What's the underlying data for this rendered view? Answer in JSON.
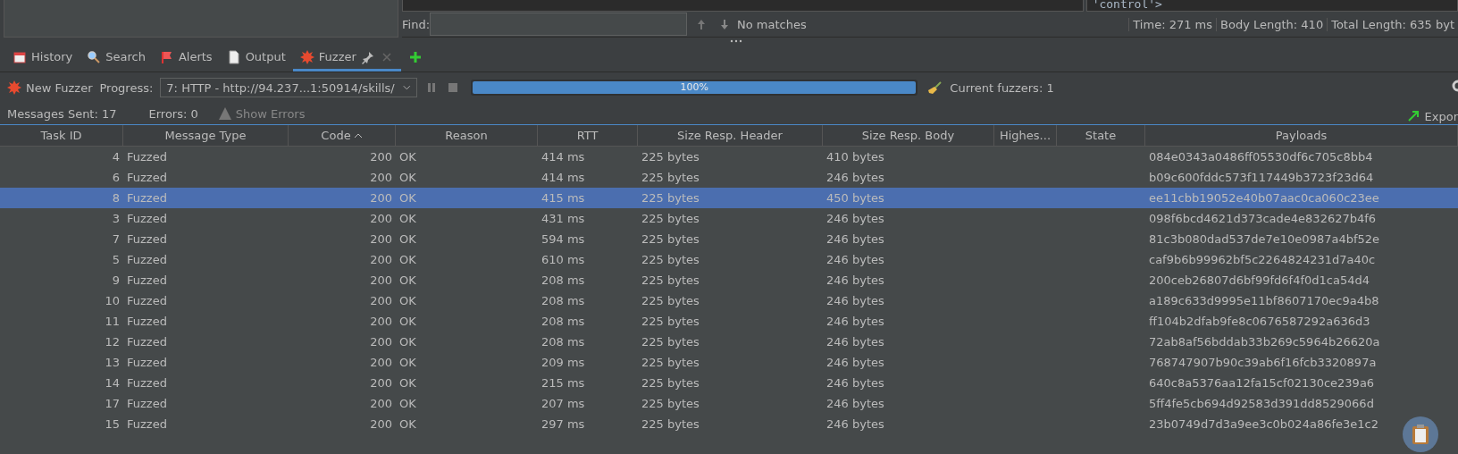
{
  "top_panel": {
    "code_snippet": "'control'>",
    "find": {
      "label": "Find:",
      "status": "No matches"
    },
    "stats": [
      "Time: 271 ms",
      "Body Length: 410",
      "Total Length: 635 byt"
    ]
  },
  "tabs": [
    {
      "label": "History",
      "kind": "calendar",
      "selected": false
    },
    {
      "label": "Search",
      "kind": "search",
      "selected": false
    },
    {
      "label": "Alerts",
      "kind": "flag",
      "selected": false
    },
    {
      "label": "Output",
      "kind": "document",
      "selected": false
    },
    {
      "label": "Fuzzer",
      "kind": "burst",
      "selected": true,
      "closable": true
    }
  ],
  "toolbar": {
    "new_button": "New Fuzzer",
    "progress_label": "Progress:",
    "progress_select": "7: HTTP - http://94.237...1:50914/skills/",
    "progress": {
      "level": 1,
      "reading": "100%"
    },
    "current_fuzzers": "Current fuzzers: 1"
  },
  "summary": {
    "messages_sent": "Messages Sent: 17",
    "errors": "Errors: 0",
    "show_errors": "Show Errors",
    "export": "Expor"
  },
  "table": {
    "columns": [
      {
        "label": "Task ID",
        "sorted": false
      },
      {
        "label": "Message Type",
        "sorted": false
      },
      {
        "label": "Code",
        "sorted": true
      },
      {
        "label": "Reason",
        "sorted": false
      },
      {
        "label": "RTT",
        "sorted": false
      },
      {
        "label": "Size Resp. Header",
        "sorted": false
      },
      {
        "label": "Size Resp. Body",
        "sorted": false
      },
      {
        "label": "Highes...",
        "sorted": false
      },
      {
        "label": "State",
        "sorted": false
      },
      {
        "label": "Payloads",
        "sorted": false
      }
    ],
    "rows": [
      {
        "cells": [
          "4",
          "Fuzzed",
          "200",
          "OK",
          "414 ms",
          "225 bytes",
          "410 bytes",
          "",
          "",
          "084e0343a0486ff05530df6c705c8bb4"
        ],
        "selected": false
      },
      {
        "cells": [
          "6",
          "Fuzzed",
          "200",
          "OK",
          "414 ms",
          "225 bytes",
          "246 bytes",
          "",
          "",
          "b09c600fddc573f117449b3723f23d64"
        ],
        "selected": false
      },
      {
        "cells": [
          "8",
          "Fuzzed",
          "200",
          "OK",
          "415 ms",
          "225 bytes",
          "450 bytes",
          "",
          "",
          "ee11cbb19052e40b07aac0ca060c23ee"
        ],
        "selected": true
      },
      {
        "cells": [
          "3",
          "Fuzzed",
          "200",
          "OK",
          "431 ms",
          "225 bytes",
          "246 bytes",
          "",
          "",
          "098f6bcd4621d373cade4e832627b4f6"
        ],
        "selected": false
      },
      {
        "cells": [
          "7",
          "Fuzzed",
          "200",
          "OK",
          "594 ms",
          "225 bytes",
          "246 bytes",
          "",
          "",
          "81c3b080dad537de7e10e0987a4bf52e"
        ],
        "selected": false
      },
      {
        "cells": [
          "5",
          "Fuzzed",
          "200",
          "OK",
          "610 ms",
          "225 bytes",
          "246 bytes",
          "",
          "",
          "caf9b6b99962bf5c2264824231d7a40c"
        ],
        "selected": false
      },
      {
        "cells": [
          "9",
          "Fuzzed",
          "200",
          "OK",
          "208 ms",
          "225 bytes",
          "246 bytes",
          "",
          "",
          "200ceb26807d6bf99fd6f4f0d1ca54d4"
        ],
        "selected": false
      },
      {
        "cells": [
          "10",
          "Fuzzed",
          "200",
          "OK",
          "208 ms",
          "225 bytes",
          "246 bytes",
          "",
          "",
          "a189c633d9995e11bf8607170ec9a4b8"
        ],
        "selected": false
      },
      {
        "cells": [
          "11",
          "Fuzzed",
          "200",
          "OK",
          "208 ms",
          "225 bytes",
          "246 bytes",
          "",
          "",
          "ff104b2dfab9fe8c0676587292a636d3"
        ],
        "selected": false
      },
      {
        "cells": [
          "12",
          "Fuzzed",
          "200",
          "OK",
          "208 ms",
          "225 bytes",
          "246 bytes",
          "",
          "",
          "72ab8af56bddab33b269c5964b26620a"
        ],
        "selected": false
      },
      {
        "cells": [
          "13",
          "Fuzzed",
          "200",
          "OK",
          "209 ms",
          "225 bytes",
          "246 bytes",
          "",
          "",
          "768747907b90c39ab6f16fcb3320897a"
        ],
        "selected": false
      },
      {
        "cells": [
          "14",
          "Fuzzed",
          "200",
          "OK",
          "215 ms",
          "225 bytes",
          "246 bytes",
          "",
          "",
          "640c8a5376aa12fa15cf02130ce239a6"
        ],
        "selected": false
      },
      {
        "cells": [
          "17",
          "Fuzzed",
          "200",
          "OK",
          "207 ms",
          "225 bytes",
          "246 bytes",
          "",
          "",
          "5ff4fe5cb694d92583d391dd8529066d"
        ],
        "selected": false
      },
      {
        "cells": [
          "15",
          "Fuzzed",
          "200",
          "OK",
          "297 ms",
          "225 bytes",
          "246 bytes",
          "",
          "",
          "23b0749d7d3a9ee3c0b024a86fe3e1c2"
        ],
        "selected": false
      }
    ]
  }
}
